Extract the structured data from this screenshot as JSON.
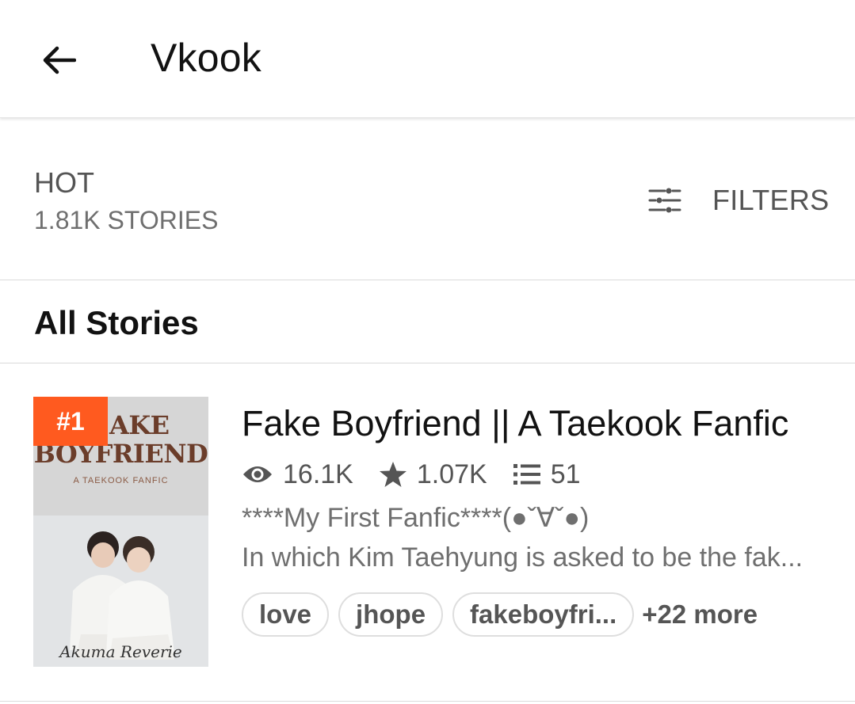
{
  "header": {
    "title": "Vkook",
    "back_icon": "arrow-left-icon"
  },
  "list_header": {
    "sort_label": "HOT",
    "count_label": "1.81K STORIES",
    "filters_label": "FILTERS",
    "filters_icon": "sliders-icon"
  },
  "section": {
    "title": "All Stories"
  },
  "stories": [
    {
      "rank": "#1",
      "title": "Fake Boyfriend || A Taekook Fanfic",
      "cover": {
        "title_line1": "AKE",
        "title_line2": "BOYFRIEND",
        "subtitle": "A TAEKOOK FANFIC",
        "author": "Akuma Reverie"
      },
      "reads": "16.1K",
      "votes": "1.07K",
      "parts": "51",
      "teaser": "****My First Fanfic****(●ˇ∀ˇ●)",
      "description": "In which Kim Taehyung is asked to be the fak...",
      "tags": [
        "love",
        "jhope",
        "fakeboyfri..."
      ],
      "more_tags": "+22 more"
    }
  ],
  "colors": {
    "accent": "#ff5a1f",
    "text": "#121212",
    "muted": "#6f6f6f",
    "divider": "#dadada"
  }
}
